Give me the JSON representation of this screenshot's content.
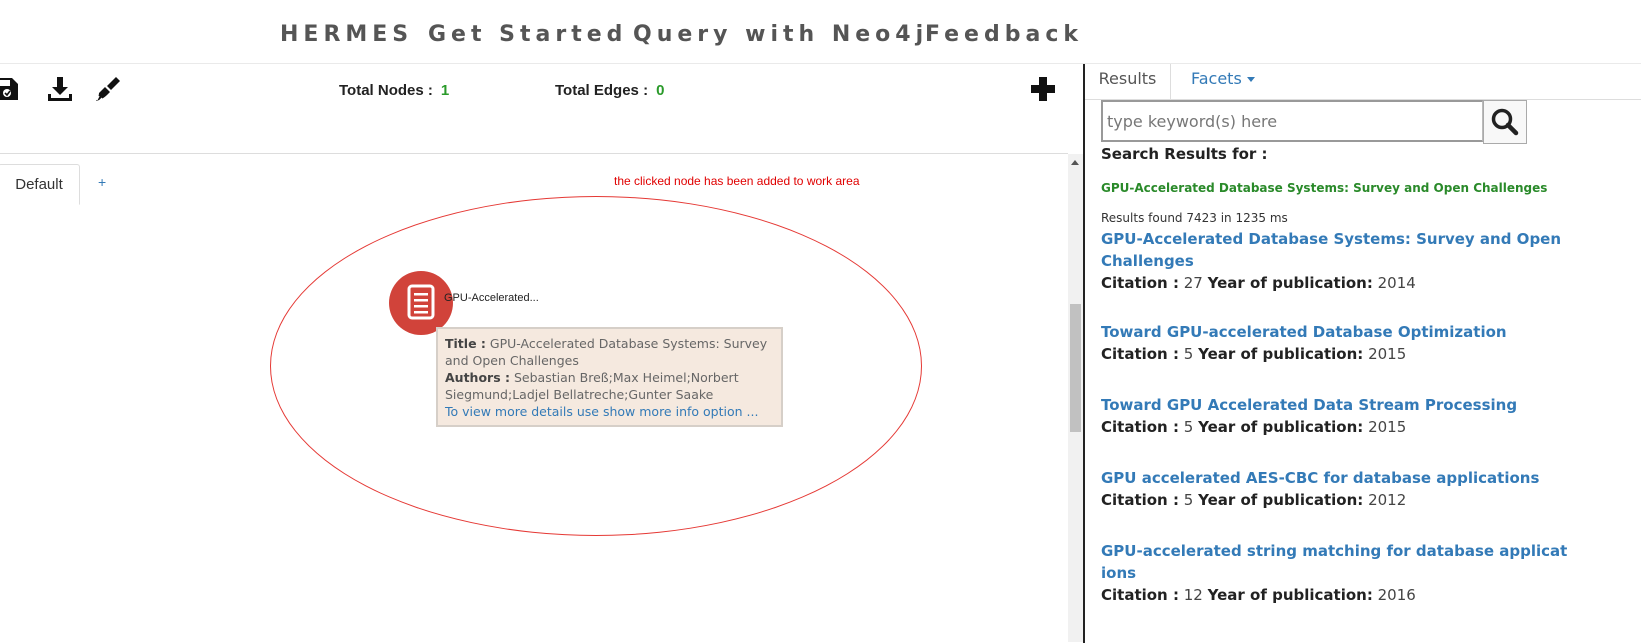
{
  "nav": {
    "items": [
      "HERMES",
      "Get Started",
      "Query with Neo4j",
      "Feedback"
    ]
  },
  "workarea": {
    "total_nodes_label": "Total Nodes :",
    "total_nodes": "1",
    "total_edges_label": "Total Edges :",
    "total_edges": "0",
    "tabs": {
      "default_label": "Default",
      "add_label": "+"
    },
    "notice": "the clicked node has been added to work area",
    "node": {
      "label": "GPU-Accelerated...",
      "icon": "document-icon",
      "color": "#d1433a"
    },
    "tooltip": {
      "title_label": "Title :",
      "title_value": "GPU-Accelerated Database Systems: Survey and Open Challenges",
      "authors_label": "Authors :",
      "authors_value": "Sebastian Breß;Max Heimel;Norbert Siegmund;Ladjel Bellatreche;Gunter Saake",
      "more_info": "To view more details use show more info option ..."
    },
    "toolbar_icons": [
      "save-graph-icon",
      "download-icon",
      "brush-icon",
      "plus-icon"
    ]
  },
  "results_panel": {
    "tabs": {
      "results": "Results",
      "facets": "Facets"
    },
    "search": {
      "placeholder": "type keyword(s) here",
      "value": ""
    },
    "search_results_for": "Search Results for :",
    "query": "GPU-Accelerated Database Systems: Survey and Open Challenges",
    "count_text": "Results found 7423 in 1235 ms",
    "citation_label": "Citation :",
    "year_label": "Year of publication:",
    "results": [
      {
        "title": "GPU-Accelerated Database Systems: Survey and Open Challenges",
        "citation": "27",
        "year": "2014"
      },
      {
        "title": "Toward GPU-accelerated Database Optimization",
        "citation": "5",
        "year": "2015"
      },
      {
        "title": "Toward GPU Accelerated Data Stream Processing",
        "citation": "5",
        "year": "2015"
      },
      {
        "title": "GPU accelerated AES-CBC for database applications",
        "citation": "5",
        "year": "2012"
      },
      {
        "title": "GPU-accelerated string matching for database applications",
        "citation": "12",
        "year": "2016"
      }
    ]
  },
  "colors": {
    "accent": "#337ab7",
    "count_green": "#2a9a2a",
    "notice_red": "#e00000",
    "node_red": "#d1433a",
    "tooltip_bg": "#f5e9df"
  }
}
